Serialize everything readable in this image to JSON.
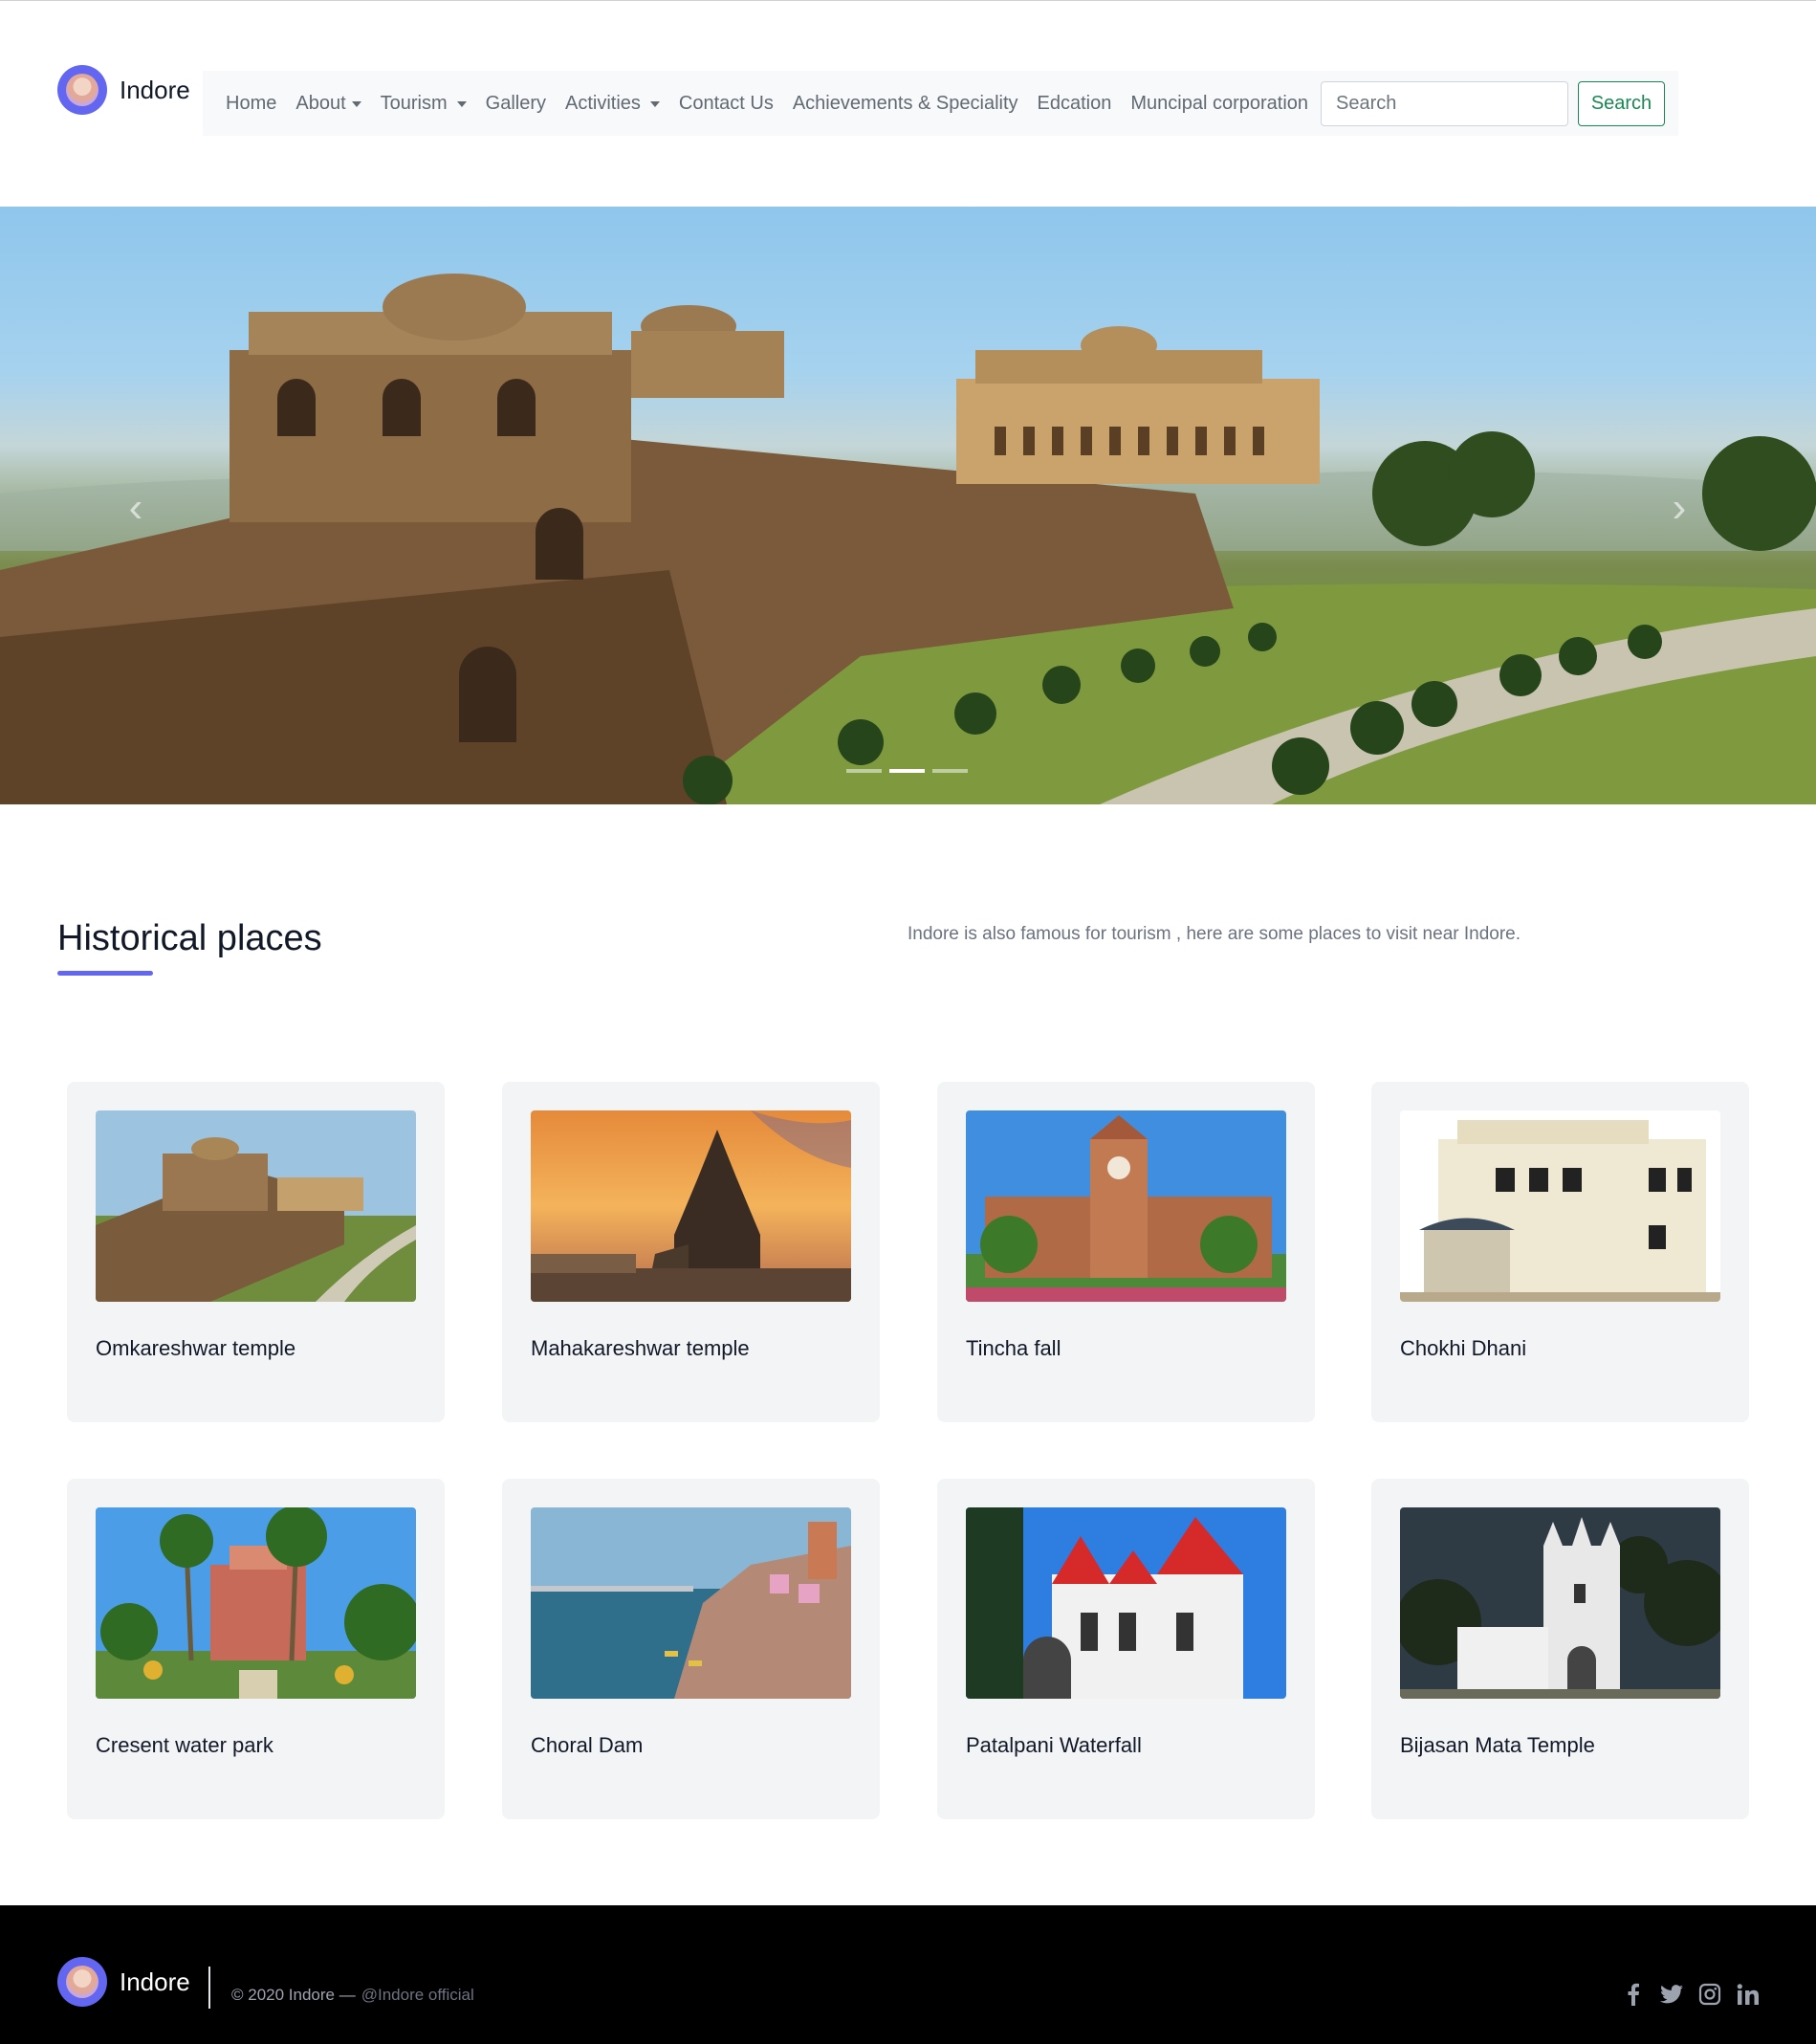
{
  "brand": {
    "name": "Indore"
  },
  "nav": {
    "items": [
      {
        "label": "Home",
        "dropdown": false
      },
      {
        "label": "About",
        "dropdown": true
      },
      {
        "label": "Tourism",
        "dropdown": true
      },
      {
        "label": "Gallery",
        "dropdown": false
      },
      {
        "label": "Activities",
        "dropdown": true
      },
      {
        "label": "Contact Us",
        "dropdown": false
      },
      {
        "label": "Achievements & Speciality",
        "dropdown": false
      },
      {
        "label": "Edcation",
        "dropdown": false
      },
      {
        "label": "Muncipal corporation",
        "dropdown": false
      }
    ],
    "search_placeholder": "Search",
    "search_button": "Search"
  },
  "hero": {
    "prev_icon": "chevron-left-icon",
    "next_icon": "chevron-right-icon",
    "slides_count": 3,
    "active_slide": 2
  },
  "section": {
    "title": "Historical places",
    "description": "Indore is also famous for tourism , here are some places to visit near Indore."
  },
  "cards": [
    {
      "title": "Omkareshwar temple"
    },
    {
      "title": "Mahakareshwar temple"
    },
    {
      "title": "Tincha fall"
    },
    {
      "title": "Chokhi Dhani"
    },
    {
      "title": "Cresent water park"
    },
    {
      "title": "Choral Dam"
    },
    {
      "title": "Patalpani Waterfall"
    },
    {
      "title": "Bijasan Mata Temple"
    }
  ],
  "footer": {
    "brand": "Indore",
    "copyright": "© 2020 Indore —",
    "handle": "@Indore official",
    "socials": [
      "facebook-icon",
      "twitter-icon",
      "instagram-icon",
      "linkedin-icon"
    ]
  },
  "colors": {
    "accent": "#6366f1",
    "search_button": "#198754",
    "card_bg": "#f3f4f6",
    "footer_bg": "#000000"
  }
}
